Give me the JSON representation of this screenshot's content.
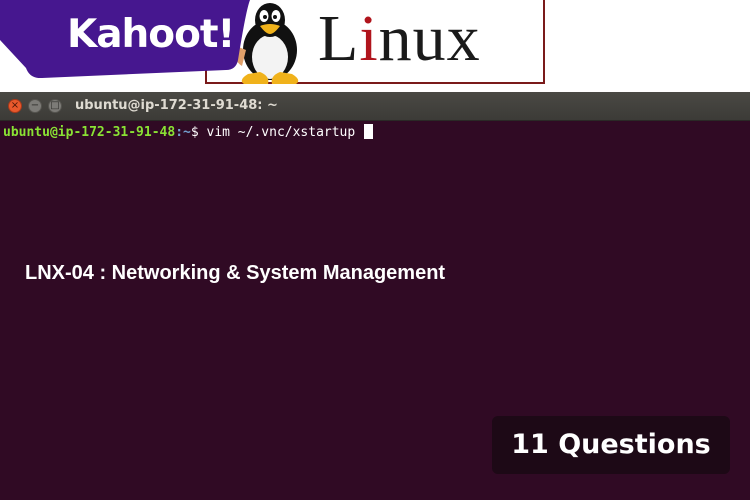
{
  "banner": {
    "kahoot_logo": "Kahoot!",
    "linux_logo": {
      "before": "L",
      "accent": "i",
      "after": "nux"
    },
    "mascot_icon": "tux-penguin-icon"
  },
  "terminal": {
    "window_title": "ubuntu@ip-172-31-91-48: ~",
    "buttons": {
      "close": "×",
      "minimize": "−",
      "maximize": "□"
    },
    "prompt": {
      "user_host": "ubuntu@ip-172-31-91-48",
      "path": ":~",
      "symbol": "$ ",
      "command": "vim ~/.vnc/xstartup"
    },
    "background_color": "#300a24"
  },
  "quiz": {
    "title": "LNX-04 : Networking & System Management",
    "question_count": "11 Questions"
  },
  "colors": {
    "kahoot_purple": "#46178f",
    "linux_red": "#b0141c",
    "prompt_green": "#8ae234",
    "prompt_blue": "#729fcf"
  }
}
